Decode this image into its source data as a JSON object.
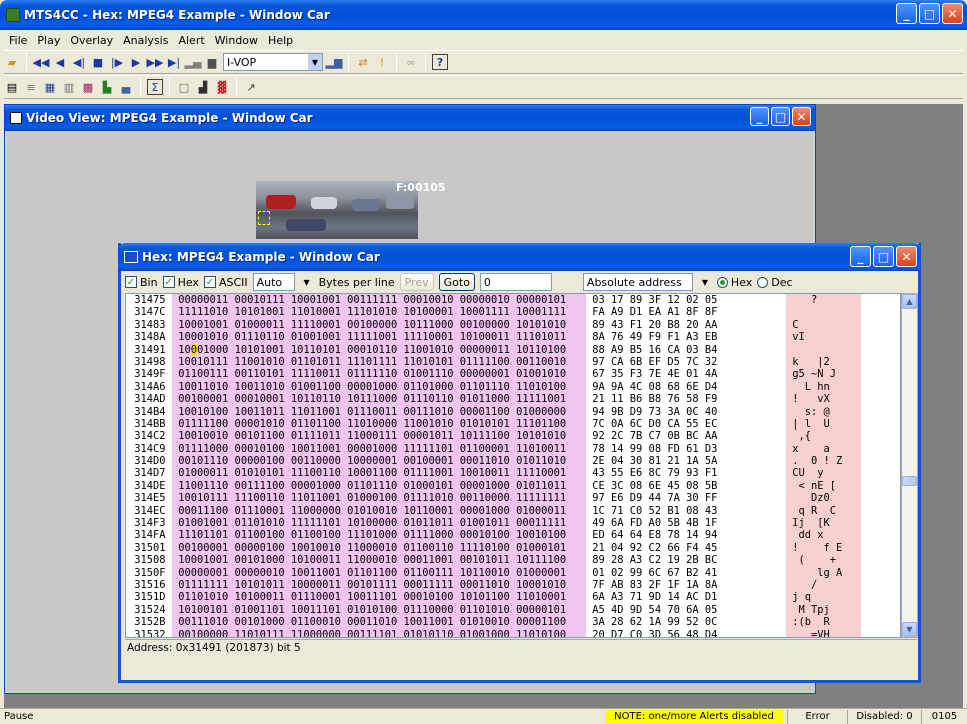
{
  "app": {
    "title": "MTS4CC - Hex: MPEG4 Example - Window Car"
  },
  "menu": [
    "File",
    "Play",
    "Overlay",
    "Analysis",
    "Alert",
    "Window",
    "Help"
  ],
  "toolbar1": {
    "frame_type": "I-VOP"
  },
  "video": {
    "title": "Video View: MPEG4 Example - Window Car",
    "frame_label": "F:00105"
  },
  "hex": {
    "title": "Hex: MPEG4 Example - Window Car",
    "opt_bin": "Bin",
    "opt_hex": "Hex",
    "opt_ascii": "ASCII",
    "auto": "Auto",
    "bytes_per_line": "Bytes per line",
    "prev": "Prev",
    "goto": "Goto",
    "goto_value": "0",
    "address_mode": "Absolute address",
    "radio_hex": "Hex",
    "radio_dec": "Dec",
    "status": "Address: 0x31491 (201873) bit 5",
    "rows": [
      [
        "31475",
        "00000011 00010111 10001001 00111111 00010010 00000010 00000101",
        "03 17 89 3F 12 02 05",
        "   ?"
      ],
      [
        "3147C",
        "11111010 10101001 11010001 11101010 10100001 10001111 10001111",
        "FA A9 D1 EA A1 8F 8F",
        ""
      ],
      [
        "31483",
        "10001001 01000011 11110001 00100000 10111000 00100000 10101010",
        "89 43 F1 20 B8 20 AA",
        "C"
      ],
      [
        "3148A",
        "10001010 01110110 01001001 11111001 11110001 10100011 11101011",
        "8A 76 49 F9 F1 A3 EB",
        "vI"
      ],
      [
        "31491",
        "10001000 10101001 10110101 00010110 11001010 00000011 10110100",
        "88 A9 B5 16 CA 03 B4",
        ""
      ],
      [
        "31498",
        "10010111 11001010 01101011 11101111 11010101 01111100 00110010",
        "97 CA 6B EF D5 7C 32",
        "k   |2"
      ],
      [
        "3149F",
        "01100111 00110101 11110011 01111110 01001110 00000001 01001010",
        "67 35 F3 7E 4E 01 4A",
        "g5 ~N J"
      ],
      [
        "314A6",
        "10011010 10011010 01001100 00001000 01101000 01101110 11010100",
        "9A 9A 4C 08 68 6E D4",
        "  L hn"
      ],
      [
        "314AD",
        "00100001 00010001 10110110 10111000 01110110 01011000 11111001",
        "21 11 B6 B8 76 58 F9",
        "!   vX"
      ],
      [
        "314B4",
        "10010100 10011011 11011001 01110011 00111010 00001100 01000000",
        "94 9B D9 73 3A 0C 40",
        "  s: @"
      ],
      [
        "314BB",
        "01111100 00001010 01101100 11010000 11001010 01010101 11101100",
        "7C 0A 6C D0 CA 55 EC",
        "| l  U"
      ],
      [
        "314C2",
        "10010010 00101100 01111011 11000111 00001011 10111100 10101010",
        "92 2C 7B C7 0B BC AA",
        " ,{"
      ],
      [
        "314C9",
        "01111000 00010100 10011001 00001000 11111101 01100001 11010011",
        "78 14 99 08 FD 61 D3",
        "x    a"
      ],
      [
        "314D0",
        "00101110 00000100 00110000 10000001 00100001 00011010 01011010",
        "2E 04 30 81 21 1A 5A",
        ".  0 ! Z"
      ],
      [
        "314D7",
        "01000011 01010101 11100110 10001100 01111001 10010011 11110001",
        "43 55 E6 8C 79 93 F1",
        "CU  y"
      ],
      [
        "314DE",
        "11001110 00111100 00001000 01101110 01000101 00001000 01011011",
        "CE 3C 08 6E 45 08 5B",
        " < nE ["
      ],
      [
        "314E5",
        "10010111 11100110 11011001 01000100 01111010 00110000 11111111",
        "97 E6 D9 44 7A 30 FF",
        "   Dz0"
      ],
      [
        "314EC",
        "00011100 01110001 11000000 01010010 10110001 00001000 01000011",
        "1C 71 C0 52 B1 08 43",
        " q R  C"
      ],
      [
        "314F3",
        "01001001 01101010 11111101 10100000 01011011 01001011 00011111",
        "49 6A FD A0 5B 4B 1F",
        "Ij  [K"
      ],
      [
        "314FA",
        "11101101 01100100 01100100 11101000 01111000 00010100 10010100",
        "ED 64 64 E8 78 14 94",
        " dd x"
      ],
      [
        "31501",
        "00100001 00000100 10010010 11000010 01100110 11110100 01000101",
        "21 04 92 C2 66 F4 45",
        "!    f E"
      ],
      [
        "31508",
        "10001001 00101000 10100011 11000010 00011001 00101011 10111100",
        "89 28 A3 C2 19 2B BC",
        " (    +"
      ],
      [
        "3150F",
        "00000001 00000010 10011001 01101100 01100111 10110010 01000001",
        "01 02 99 6C 67 B2 41",
        "    lg A"
      ],
      [
        "31516",
        "01111111 10101011 10000011 00101111 00011111 00011010 10001010",
        "7F AB 83 2F 1F 1A 8A",
        "   /"
      ],
      [
        "3151D",
        "01101010 10100011 01110001 10011101 00010100 10101100 11010001",
        "6A A3 71 9D 14 AC D1",
        "j q"
      ],
      [
        "31524",
        "10100101 01001101 10011101 01010100 01110000 01101010 00000101",
        "A5 4D 9D 54 70 6A 05",
        " M Tpj"
      ],
      [
        "3152B",
        "00111010 00101000 01100010 00011010 10011001 01010010 00001100",
        "3A 28 62 1A 99 52 0C",
        ":(b  R"
      ],
      [
        "31532",
        "00100000 11010111 11000000 00111101 01010110 01001000 11010100",
        "20 D7 C0 3D 56 48 D4",
        "   =VH"
      ]
    ]
  },
  "statusbar": {
    "state": "Pause",
    "note": "NOTE: one/more Alerts disabled",
    "error": "Error",
    "disabled": "Disabled: 0",
    "frame": "0105"
  }
}
